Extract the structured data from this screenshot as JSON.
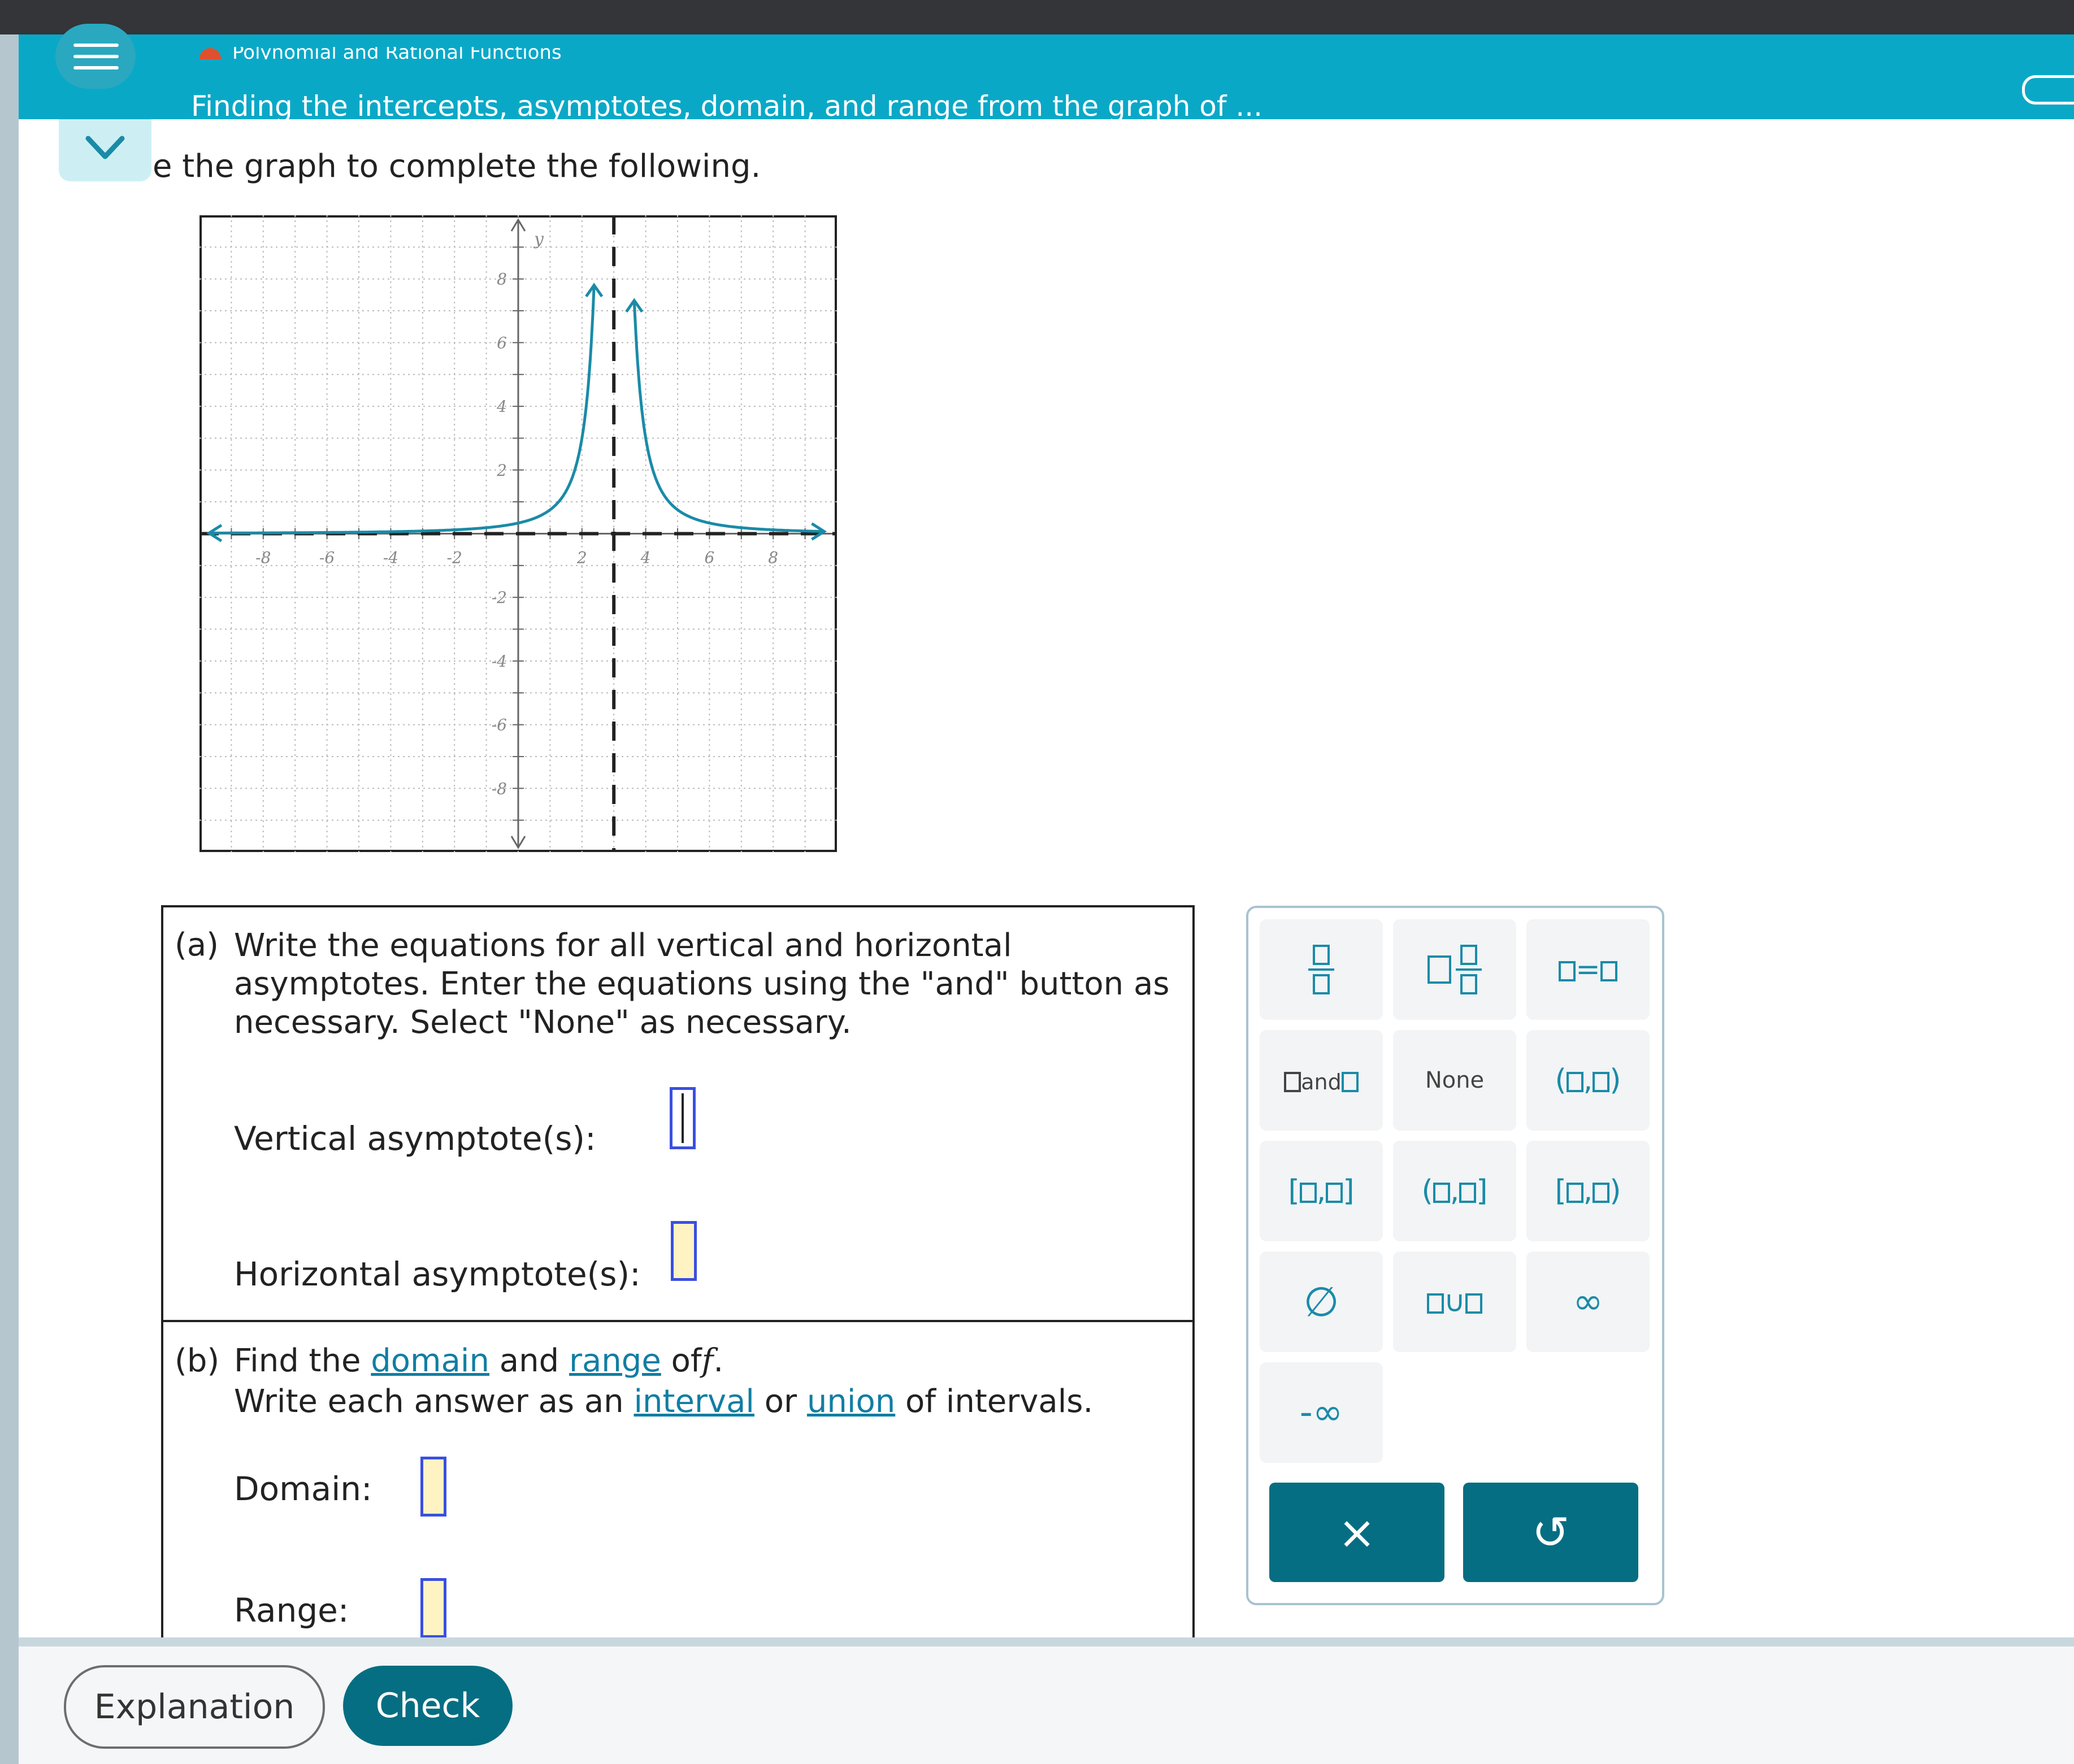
{
  "header": {
    "breadcrumb": "Polynomial and Rational Functions",
    "title": "Finding the intercepts, asymptotes, domain, and range from the graph of ..."
  },
  "instruction": "e the graph to complete the following.",
  "graph": {
    "y_label": "y",
    "x_ticks": [
      "-8",
      "-6",
      "-4",
      "-2",
      "2",
      "4",
      "6",
      "8"
    ],
    "y_ticks": [
      "8",
      "6",
      "4",
      "2",
      "-2",
      "-4",
      "-6",
      "-8"
    ],
    "xlim": [
      -10,
      10
    ],
    "ylim": [
      -10,
      10
    ],
    "vertical_asymptote_x": 3,
    "horizontal_asymptote_y": 0,
    "grid": true,
    "curve_color": "#1a8ba7"
  },
  "part_a": {
    "prefix": "(a)",
    "line1": "Write the equations for all vertical and horizontal",
    "line2": "asymptotes. Enter the equations using the \"and\" button as",
    "line3": "necessary. Select \"None\" as necessary.",
    "vertical_label": "Vertical asymptote(s):",
    "horizontal_label": "Horizontal asymptote(s):"
  },
  "part_b": {
    "prefix": "(b)",
    "find": "Find the",
    "domain_link": "domain",
    "and": "and",
    "range_link": "range",
    "of": "of",
    "f": "f",
    "period": ".",
    "write": "Write each answer as an",
    "interval_link": "interval",
    "or": "or",
    "union_link": "union",
    "of_intervals": "of intervals.",
    "domain_label": "Domain:",
    "range_label": "Range:"
  },
  "palette": {
    "and_text": "and",
    "none_label": "None",
    "comma": ",",
    "union_sym": "∪",
    "equals_sym": "=",
    "empty_set": "∅",
    "infinity": "∞",
    "neg_infinity": "-∞",
    "clear": "×",
    "undo": "↺"
  },
  "footer": {
    "explanation": "Explanation",
    "check": "Check"
  },
  "colors": {
    "header": "#0aa8c7",
    "primary_button": "#066e82",
    "accent": "#1a8ba7",
    "answer_box_fill": "#fff3c4",
    "answer_box_border": "#3b4fe0"
  }
}
